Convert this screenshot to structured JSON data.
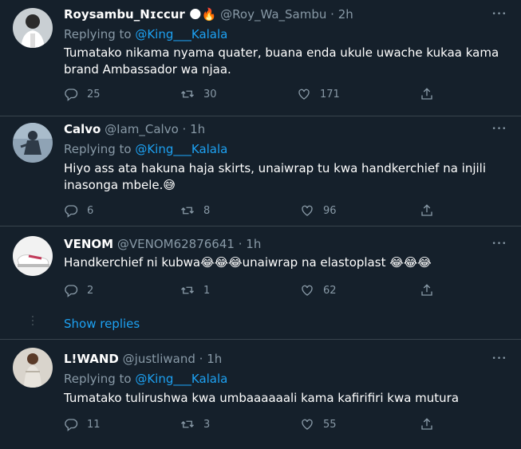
{
  "tweets": [
    {
      "name": "Roysambu_Nɪccur 🌑🔥",
      "handle": "@Roy_Wa_Sambu",
      "time": "2h",
      "replying_prefix": "Replying to ",
      "replying_to": "@King___Kalala",
      "text": "Tumatako nikama nyama quater, buana enda ukule uwache kukaa kama brand Ambassador wa njaa.",
      "replies": "25",
      "retweets": "30",
      "likes": "171"
    },
    {
      "name": "Calvo",
      "handle": "@Iam_Calvo",
      "time": "1h",
      "replying_prefix": "Replying to ",
      "replying_to": "@King___Kalala",
      "text": "Hiyo ass ata hakuna haja skirts, unaiwrap tu kwa handkerchief na injili inasonga mbele.😅",
      "replies": "6",
      "retweets": "8",
      "likes": "96"
    },
    {
      "name": "VENOM",
      "handle": "@VENOM62876641",
      "time": "1h",
      "text": "Handkerchief ni kubwa😂😂😂unaiwrap na elastoplast 😂😂😂",
      "replies": "2",
      "retweets": "1",
      "likes": "62"
    },
    {
      "name": "L!WAND",
      "handle": "@justliwand",
      "time": "1h",
      "replying_prefix": "Replying to ",
      "replying_to": "@King___Kalala",
      "text": "Tumatako tulirushwa kwa umbaaaaaali kama kafirifiri kwa mutura",
      "replies": "11",
      "retweets": "3",
      "likes": "55"
    }
  ],
  "show_replies": "Show replies",
  "separator": "·",
  "more_glyph": "•••",
  "colors": {
    "background": "#15202b",
    "divider": "#38444d",
    "secondary_text": "#8899a6",
    "accent": "#1da1f2"
  },
  "icons": [
    "reply-icon",
    "retweet-icon",
    "like-icon",
    "share-icon",
    "more-icon"
  ]
}
